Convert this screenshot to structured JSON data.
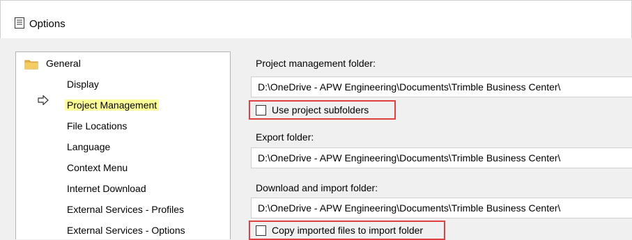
{
  "window": {
    "title": "Options"
  },
  "tree": {
    "root_label": "General",
    "items": [
      {
        "label": "Display",
        "selected": false
      },
      {
        "label": "Project Management",
        "selected": true
      },
      {
        "label": "File Locations",
        "selected": false
      },
      {
        "label": "Language",
        "selected": false
      },
      {
        "label": "Context Menu",
        "selected": false
      },
      {
        "label": "Internet Download",
        "selected": false
      },
      {
        "label": "External Services - Profiles",
        "selected": false
      },
      {
        "label": "External Services - Options",
        "selected": false
      }
    ]
  },
  "settings": {
    "project_folder": {
      "label": "Project management folder:",
      "value": "D:\\OneDrive - APW Engineering\\Documents\\Trimble Business Center\\"
    },
    "use_subfolders": {
      "label": "Use project subfolders",
      "checked": false
    },
    "export_folder": {
      "label": "Export folder:",
      "value": "D:\\OneDrive - APW Engineering\\Documents\\Trimble Business Center\\"
    },
    "import_folder": {
      "label": "Download and import folder:",
      "value": "D:\\OneDrive - APW Engineering\\Documents\\Trimble Business Center\\"
    },
    "copy_imported": {
      "label": "Copy imported files to import folder",
      "checked": false
    }
  },
  "colors": {
    "highlight": "#ffff99",
    "annotation_box": "#e0403f",
    "folder": "#e8b84a"
  }
}
